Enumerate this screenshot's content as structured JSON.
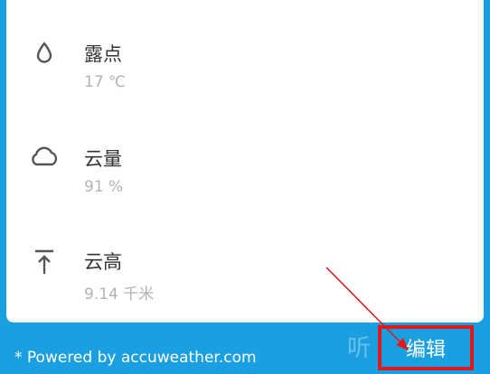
{
  "details": [
    {
      "label": "露点",
      "value": "17 ℃",
      "icon": "dew-drop-icon"
    },
    {
      "label": "云量",
      "value": "91 %",
      "icon": "cloud-icon"
    },
    {
      "label": "云高",
      "value": "9.14 千米",
      "icon": "cloud-ceiling-icon"
    }
  ],
  "footer": {
    "powered_by": "* Powered by accuweather.com",
    "edit_label": "编辑",
    "watermark": "听"
  },
  "colors": {
    "background": "#1a9fe0",
    "highlight": "#e0191c"
  }
}
